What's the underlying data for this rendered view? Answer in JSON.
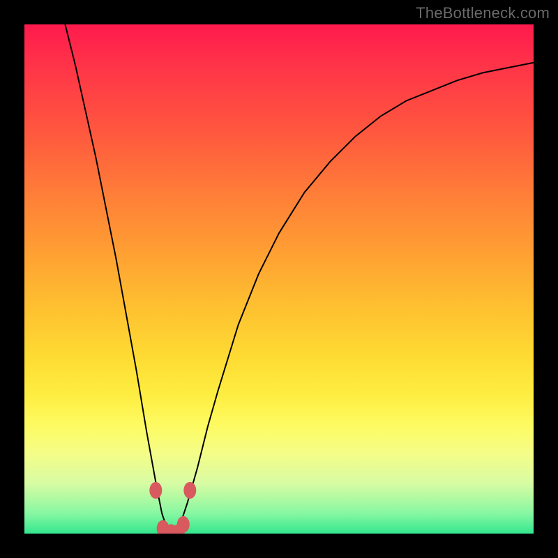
{
  "watermark": "TheBottleneck.com",
  "chart_data": {
    "type": "line",
    "title": "",
    "xlabel": "",
    "ylabel": "",
    "x": [
      0.08,
      0.1,
      0.12,
      0.14,
      0.16,
      0.18,
      0.2,
      0.22,
      0.24,
      0.26,
      0.27,
      0.28,
      0.285,
      0.29,
      0.3,
      0.31,
      0.32,
      0.34,
      0.36,
      0.38,
      0.42,
      0.46,
      0.5,
      0.55,
      0.6,
      0.65,
      0.7,
      0.75,
      0.8,
      0.85,
      0.9,
      0.95,
      1.0
    ],
    "values": [
      1.0,
      0.92,
      0.83,
      0.74,
      0.64,
      0.54,
      0.43,
      0.32,
      0.2,
      0.09,
      0.04,
      0.01,
      0.0,
      0.0,
      0.01,
      0.03,
      0.06,
      0.13,
      0.21,
      0.28,
      0.41,
      0.51,
      0.59,
      0.67,
      0.73,
      0.78,
      0.82,
      0.85,
      0.87,
      0.89,
      0.905,
      0.915,
      0.925
    ],
    "xlim": [
      0,
      1
    ],
    "ylim": [
      0,
      1
    ],
    "markers": {
      "x": [
        0.258,
        0.272,
        0.288,
        0.302,
        0.312,
        0.325
      ],
      "y": [
        0.085,
        0.01,
        0.002,
        0.002,
        0.018,
        0.085
      ],
      "color": "#d85a5f"
    },
    "background_gradient": {
      "top": "#ff1a4d",
      "mid": "#fedd33",
      "bottom": "#33e78f"
    }
  }
}
